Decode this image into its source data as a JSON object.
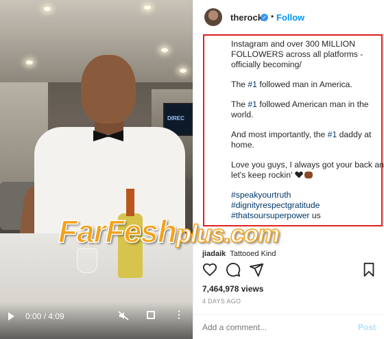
{
  "video": {
    "time": "0:00 / 4:09",
    "tv_text": "DIREC"
  },
  "header": {
    "username": "therock",
    "separator": "•",
    "follow_label": "Follow"
  },
  "caption": {
    "p1": "Instagram and over 300 MILLION FOLLOWERS across all platforms - officially becoming/",
    "p2_pre": "The ",
    "p2_tag": "#1",
    "p2_post": " followed man in America.",
    "p3_pre": "The ",
    "p3_tag": "#1",
    "p3_post": " followed American man in the world.",
    "p4_pre": "And most importantly, the ",
    "p4_tag": "#1",
    "p4_post": " daddy at home.",
    "p5": "Love you guys, I always got your back and let's keep rockin' ",
    "tag1": "#speakyourtruth",
    "tag2": "#dignityrespectgratitude",
    "tag3": "#thatsoursuperpower",
    "tag3_post": " us"
  },
  "comment_peek": {
    "user": "jiadaik",
    "text": "Tattooed Kind"
  },
  "watermark": {
    "main": "FarFesh",
    "suffix": "plus.com"
  },
  "stats": {
    "views": "7,464,978 views",
    "ago": "4 DAYS AGO"
  },
  "comment_box": {
    "placeholder": "Add a comment...",
    "post_label": "Post"
  },
  "colors": {
    "accent": "#0095f6",
    "highlight_box": "#e02020",
    "hashtag": "#00376b",
    "watermark": "#f3a21b"
  }
}
